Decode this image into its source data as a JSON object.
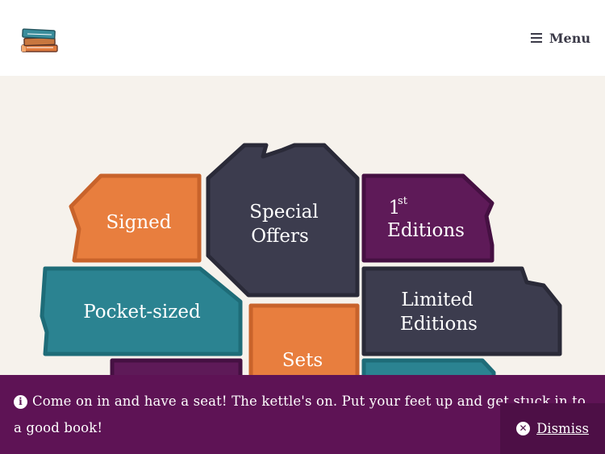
{
  "header": {
    "logo_icon": "stacked-books-icon",
    "menu_label": "Menu",
    "menu_icon": "hamburger-icon"
  },
  "tiles": {
    "signed": "Signed",
    "special_offers_line1": "Special",
    "special_offers_line2": "Offers",
    "first_editions_number": "1",
    "first_editions_suffix": "st",
    "first_editions_word": "Editions",
    "pocket_sized": "Pocket-sized",
    "limited_editions_line1": "Limited",
    "limited_editions_line2": "Editions",
    "sets": "Sets"
  },
  "colors": {
    "orange": "#e87e3e",
    "orange_border": "#c8632b",
    "slate": "#3c3c4e",
    "slate_border": "#2a2a38",
    "plum": "#5e1a58",
    "plum_border": "#451042",
    "teal": "#2b8391",
    "teal_border": "#1e6c78",
    "banner": "#5e1355",
    "hero_bg": "#f6f2ec"
  },
  "banner": {
    "info_icon": "info-icon",
    "message": "Come on in and have a seat! The kettle's on. Put your feet up and get stuck in to a good book!",
    "dismiss_label": "Dismiss",
    "dismiss_icon": "close-circle-icon"
  }
}
